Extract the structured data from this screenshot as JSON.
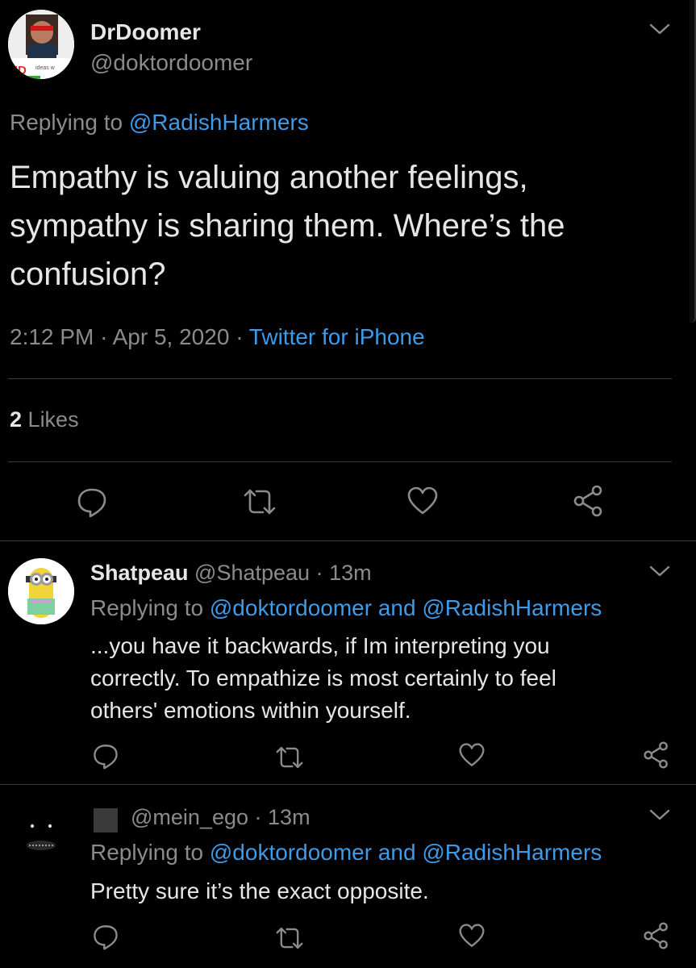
{
  "main_tweet": {
    "display_name": "DrDoomer",
    "handle": "@doktordoomer",
    "replying_prefix": "Replying to",
    "replying_to": "@RadishHarmers",
    "text_line1": "Empathy is valuing another feelings,",
    "text_line2": "sympathy is sharing them.  Where’s the",
    "text_line3": "confusion?",
    "time": "2:12 PM",
    "date": "Apr 5, 2020",
    "source": "Twitter for iPhone",
    "likes_count": "2",
    "likes_label": "Likes",
    "avatar_text": "ED",
    "avatar_subtext": "ideas w"
  },
  "replies": [
    {
      "display_name": "Shatpeau",
      "handle": "@Shatpeau",
      "age": "13m",
      "replying_prefix": "Replying to",
      "replying_to_1": "@doktordoomer",
      "and": "and",
      "replying_to_2": "@RadishHarmers",
      "text_line1": "...you have it backwards, if Im interpreting you",
      "text_line2": "correctly. To empathize is most certainly to feel",
      "text_line3": "others' emotions within yourself."
    },
    {
      "display_name": "",
      "handle": "@mein_ego",
      "age": "13m",
      "replying_prefix": "Replying to",
      "replying_to_1": "@doktordoomer",
      "and": "and",
      "replying_to_2": "@RadishHarmers",
      "text_line1": "Pretty sure it’s the exact opposite."
    }
  ],
  "separator": "·",
  "icons": [
    "chevron-down-icon",
    "reply-icon",
    "retweet-icon",
    "like-icon",
    "share-icon"
  ],
  "colors": {
    "background": "#000000",
    "link": "#3d9be9",
    "muted": "#8b8b8b",
    "text": "#e6e6e6"
  }
}
